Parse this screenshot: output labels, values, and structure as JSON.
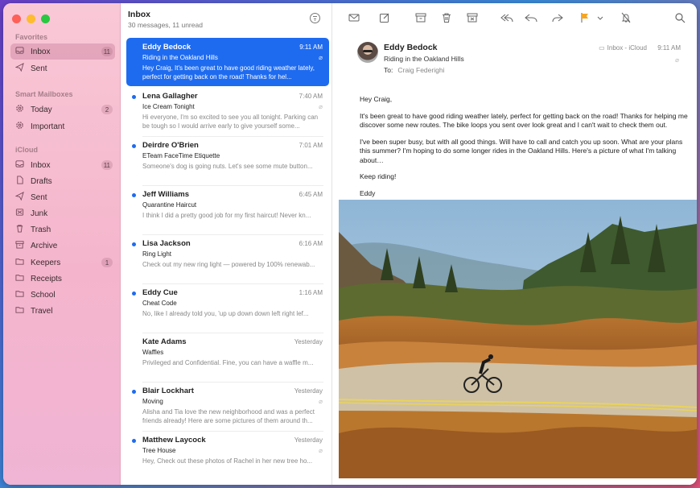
{
  "sidebar": {
    "sections": [
      {
        "title": "Favorites",
        "items": [
          {
            "label": "Inbox",
            "icon": "inbox-icon",
            "badge": "11",
            "selected": true
          },
          {
            "label": "Sent",
            "icon": "paperplane-icon",
            "badge": ""
          }
        ]
      },
      {
        "title": "Smart Mailboxes",
        "items": [
          {
            "label": "Today",
            "icon": "gear-icon",
            "badge": "2"
          },
          {
            "label": "Important",
            "icon": "gear-icon",
            "badge": ""
          }
        ]
      },
      {
        "title": "iCloud",
        "items": [
          {
            "label": "Inbox",
            "icon": "inbox-icon",
            "badge": "11"
          },
          {
            "label": "Drafts",
            "icon": "document-icon",
            "badge": ""
          },
          {
            "label": "Sent",
            "icon": "paperplane-icon",
            "badge": ""
          },
          {
            "label": "Junk",
            "icon": "junk-icon",
            "badge": ""
          },
          {
            "label": "Trash",
            "icon": "trash-icon",
            "badge": ""
          },
          {
            "label": "Archive",
            "icon": "archive-icon",
            "badge": ""
          },
          {
            "label": "Keepers",
            "icon": "folder-icon",
            "badge": "1"
          },
          {
            "label": "Receipts",
            "icon": "folder-icon",
            "badge": ""
          },
          {
            "label": "School",
            "icon": "folder-icon",
            "badge": ""
          },
          {
            "label": "Travel",
            "icon": "folder-icon",
            "badge": ""
          }
        ]
      }
    ]
  },
  "list": {
    "title": "Inbox",
    "subtitle": "30 messages, 11 unread",
    "messages": [
      {
        "sender": "Eddy Bedock",
        "time": "9:11 AM",
        "subject": "Riding in the Oakland Hills",
        "preview": "Hey Craig, It's been great to have good riding weather lately, perfect for getting back on the road! Thanks for hel...",
        "unread": false,
        "selected": true,
        "attachment": true
      },
      {
        "sender": "Lena Gallagher",
        "time": "7:40 AM",
        "subject": "Ice Cream Tonight",
        "preview": "Hi everyone, I'm so excited to see you all tonight. Parking can be tough so I would arrive early to give yourself some...",
        "unread": true,
        "selected": false,
        "attachment": true
      },
      {
        "sender": "Deirdre O'Brien",
        "time": "7:01 AM",
        "subject": "ETeam FaceTime Etiquette",
        "preview": "Someone's dog is going nuts. Let's see some mute button...",
        "unread": true,
        "selected": false,
        "attachment": false
      },
      {
        "sender": "Jeff Williams",
        "time": "6:45 AM",
        "subject": "Quarantine Haircut",
        "preview": "I think I did a pretty good job for my first haircut! Never kn...",
        "unread": true,
        "selected": false,
        "attachment": false
      },
      {
        "sender": "Lisa Jackson",
        "time": "6:16 AM",
        "subject": "Ring Light",
        "preview": "Check out my new ring light — powered by 100% renewab...",
        "unread": true,
        "selected": false,
        "attachment": false
      },
      {
        "sender": "Eddy Cue",
        "time": "1:16 AM",
        "subject": "Cheat Code",
        "preview": "No, like I already told you, 'up up down down left right lef...",
        "unread": true,
        "selected": false,
        "attachment": false
      },
      {
        "sender": "Kate Adams",
        "time": "Yesterday",
        "subject": "Waffles",
        "preview": "Privileged and Confidential. Fine, you can have a waffle m...",
        "unread": false,
        "selected": false,
        "attachment": false
      },
      {
        "sender": "Blair Lockhart",
        "time": "Yesterday",
        "subject": "Moving",
        "preview": "Alisha and Tia love the new neighborhood and was a perfect friends already! Here are some pictures of them around th...",
        "unread": true,
        "selected": false,
        "attachment": true
      },
      {
        "sender": "Matthew Laycock",
        "time": "Yesterday",
        "subject": "Tree House",
        "preview": "Hey, Check out these photos of Rachel in her new tree ho...",
        "unread": true,
        "selected": false,
        "attachment": true
      }
    ]
  },
  "reader": {
    "sender": "Eddy Bedock",
    "subject": "Riding in the Oakland Hills",
    "to_label": "To:",
    "to_name": "Craig Federighi",
    "mailbox": "Inbox - iCloud",
    "time": "9:11 AM",
    "body": [
      "Hey Craig,",
      "It's been great to have good riding weather lately, perfect for getting back on the road! Thanks for helping me discover some new routes. The bike loops you sent over look great and I can't wait to check them out.",
      "I've been super busy, but with all good things. Will have to call and catch you up soon. What are your plans this summer? I'm hoping to do some longer rides in the Oakland Hills. Here's a picture of what I'm talking about…",
      "Keep riding!",
      "Eddy"
    ]
  },
  "colors": {
    "accent": "#1e6bf0",
    "flag": "#f5a623"
  }
}
